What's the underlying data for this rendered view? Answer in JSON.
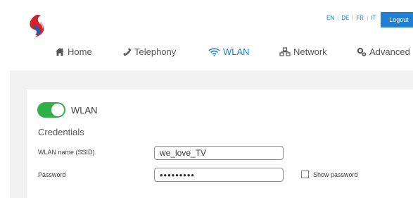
{
  "header": {
    "languages": [
      "EN",
      "DE",
      "FR",
      "IT"
    ],
    "language_separator": "|",
    "logout_label": "Logout"
  },
  "nav": {
    "items": [
      {
        "label": "Home",
        "icon": "home-icon"
      },
      {
        "label": "Telephony",
        "icon": "phone-icon"
      },
      {
        "label": "WLAN",
        "icon": "wifi-icon",
        "active": true
      },
      {
        "label": "Network",
        "icon": "network-icon"
      },
      {
        "label": "Advanced",
        "icon": "advanced-settings-icon"
      }
    ]
  },
  "wlan": {
    "toggle_on": true,
    "toggle_label": "WLAN",
    "section_title": "Credentials",
    "ssid_label": "WLAN name (SSID)",
    "ssid_value": "we_love_TV",
    "password_label": "Password",
    "password_masked": "•••••••••",
    "show_password_label": "Show password",
    "show_password_checked": false
  },
  "colors": {
    "accent": "#1a7fd1",
    "toggle_on": "#2fb24a",
    "background": "#f1f1f1"
  }
}
